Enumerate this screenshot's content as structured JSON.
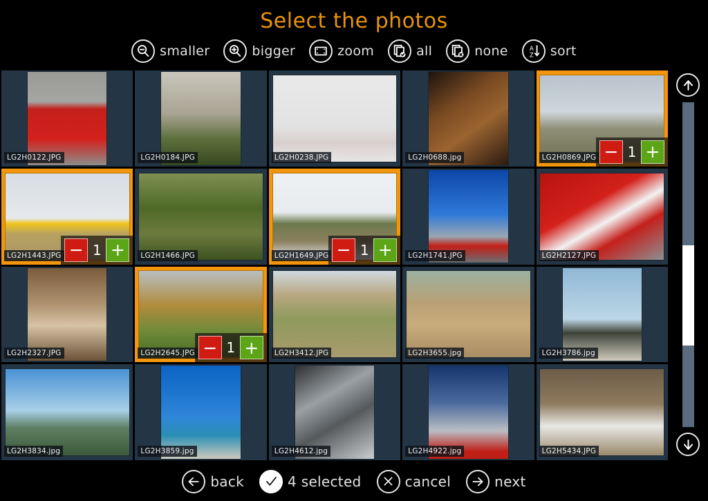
{
  "header": {
    "title": "Select the photos",
    "tools": [
      {
        "label": "smaller",
        "icon": "magnifier-minus-icon"
      },
      {
        "label": "bigger",
        "icon": "magnifier-plus-icon"
      },
      {
        "label": "zoom",
        "icon": "zoom-frame-icon"
      },
      {
        "label": "all",
        "icon": "pages-check-icon"
      },
      {
        "label": "none",
        "icon": "pages-cross-icon"
      },
      {
        "label": "sort",
        "icon": "sort-az-icon"
      }
    ]
  },
  "grid": {
    "columns": 5,
    "rows": 4,
    "items": [
      {
        "filename": "LG2H0122.JPG",
        "selected": false,
        "count": null,
        "orientation": "portrait",
        "subject": "red-convertible-car"
      },
      {
        "filename": "LG2H0184.JPG",
        "selected": false,
        "count": null,
        "orientation": "portrait",
        "subject": "tall-forest-trees"
      },
      {
        "filename": "LG2H0238.JPG",
        "selected": false,
        "count": null,
        "orientation": "landscape",
        "subject": "car-in-fog"
      },
      {
        "filename": "LG2H0688.jpg",
        "selected": false,
        "count": null,
        "orientation": "portrait",
        "subject": "whisky-barrels"
      },
      {
        "filename": "LG2H0869.JPG",
        "selected": true,
        "count": "1",
        "orientation": "landscape",
        "subject": "fighter-jet"
      },
      {
        "filename": "LG2H1443.JPG",
        "selected": true,
        "count": "1",
        "orientation": "landscape",
        "subject": "yellow-biplane"
      },
      {
        "filename": "LG2H1466.JPG",
        "selected": false,
        "count": null,
        "orientation": "landscape",
        "subject": "tree-branches"
      },
      {
        "filename": "LG2H1649.JPG",
        "selected": true,
        "count": "1",
        "orientation": "landscape",
        "subject": "camouflage-helicopter"
      },
      {
        "filename": "LG2H1741.JPG",
        "selected": false,
        "count": null,
        "orientation": "portrait",
        "subject": "red-sports-car-sky"
      },
      {
        "filename": "LG2H2127.JPG",
        "selected": false,
        "count": null,
        "orientation": "landscape",
        "subject": "red-race-car-15"
      },
      {
        "filename": "LG2H2327.JPG",
        "selected": false,
        "count": null,
        "orientation": "portrait",
        "subject": "meerkat"
      },
      {
        "filename": "LG2H2645.JPG",
        "selected": true,
        "count": "1",
        "orientation": "landscape",
        "subject": "lion-in-grass"
      },
      {
        "filename": "LG2H3412.JPG",
        "selected": false,
        "count": null,
        "orientation": "landscape",
        "subject": "aerial-farmland"
      },
      {
        "filename": "LG2H3655.jpg",
        "selected": false,
        "count": null,
        "orientation": "landscape",
        "subject": "outback-cottage"
      },
      {
        "filename": "LG2H3786.jpg",
        "selected": false,
        "count": null,
        "orientation": "portrait",
        "subject": "sculpture-on-beach"
      },
      {
        "filename": "LG2H3834.jpg",
        "selected": false,
        "count": null,
        "orientation": "landscape",
        "subject": "coastline-viewpoint"
      },
      {
        "filename": "LG2H3859.jpg",
        "selected": false,
        "count": null,
        "orientation": "portrait",
        "subject": "seagull-on-post"
      },
      {
        "filename": "LG2H4612.jpg",
        "selected": false,
        "count": null,
        "orientation": "portrait",
        "subject": "stacked-pipes"
      },
      {
        "filename": "LG2H4922.jpg",
        "selected": false,
        "count": null,
        "orientation": "portrait",
        "subject": "wedding-couple-pavilion"
      },
      {
        "filename": "LG2H5434.JPG",
        "selected": false,
        "count": null,
        "orientation": "landscape",
        "subject": "seagull-on-steps"
      }
    ],
    "stepper": {
      "minus_label": "−",
      "plus_label": "+"
    }
  },
  "scrollbar": {
    "up_icon": "arrow-up-icon",
    "down_icon": "arrow-down-icon",
    "thumb_top_pct": 44,
    "thumb_height_pct": 31
  },
  "bottombar": {
    "items": [
      {
        "label": "back",
        "icon": "arrow-left-circle-icon",
        "filled": false
      },
      {
        "label": "4 selected",
        "icon": "check-circle-icon",
        "filled": true
      },
      {
        "label": "cancel",
        "icon": "cross-circle-icon",
        "filled": false
      },
      {
        "label": "next",
        "icon": "arrow-right-circle-icon",
        "filled": false
      }
    ]
  },
  "colors": {
    "title": "#e8940c",
    "selection": "#f2960d",
    "cell_bg": "#243645",
    "minus": "#d01b13",
    "plus": "#5ba516",
    "background": "#000000"
  }
}
